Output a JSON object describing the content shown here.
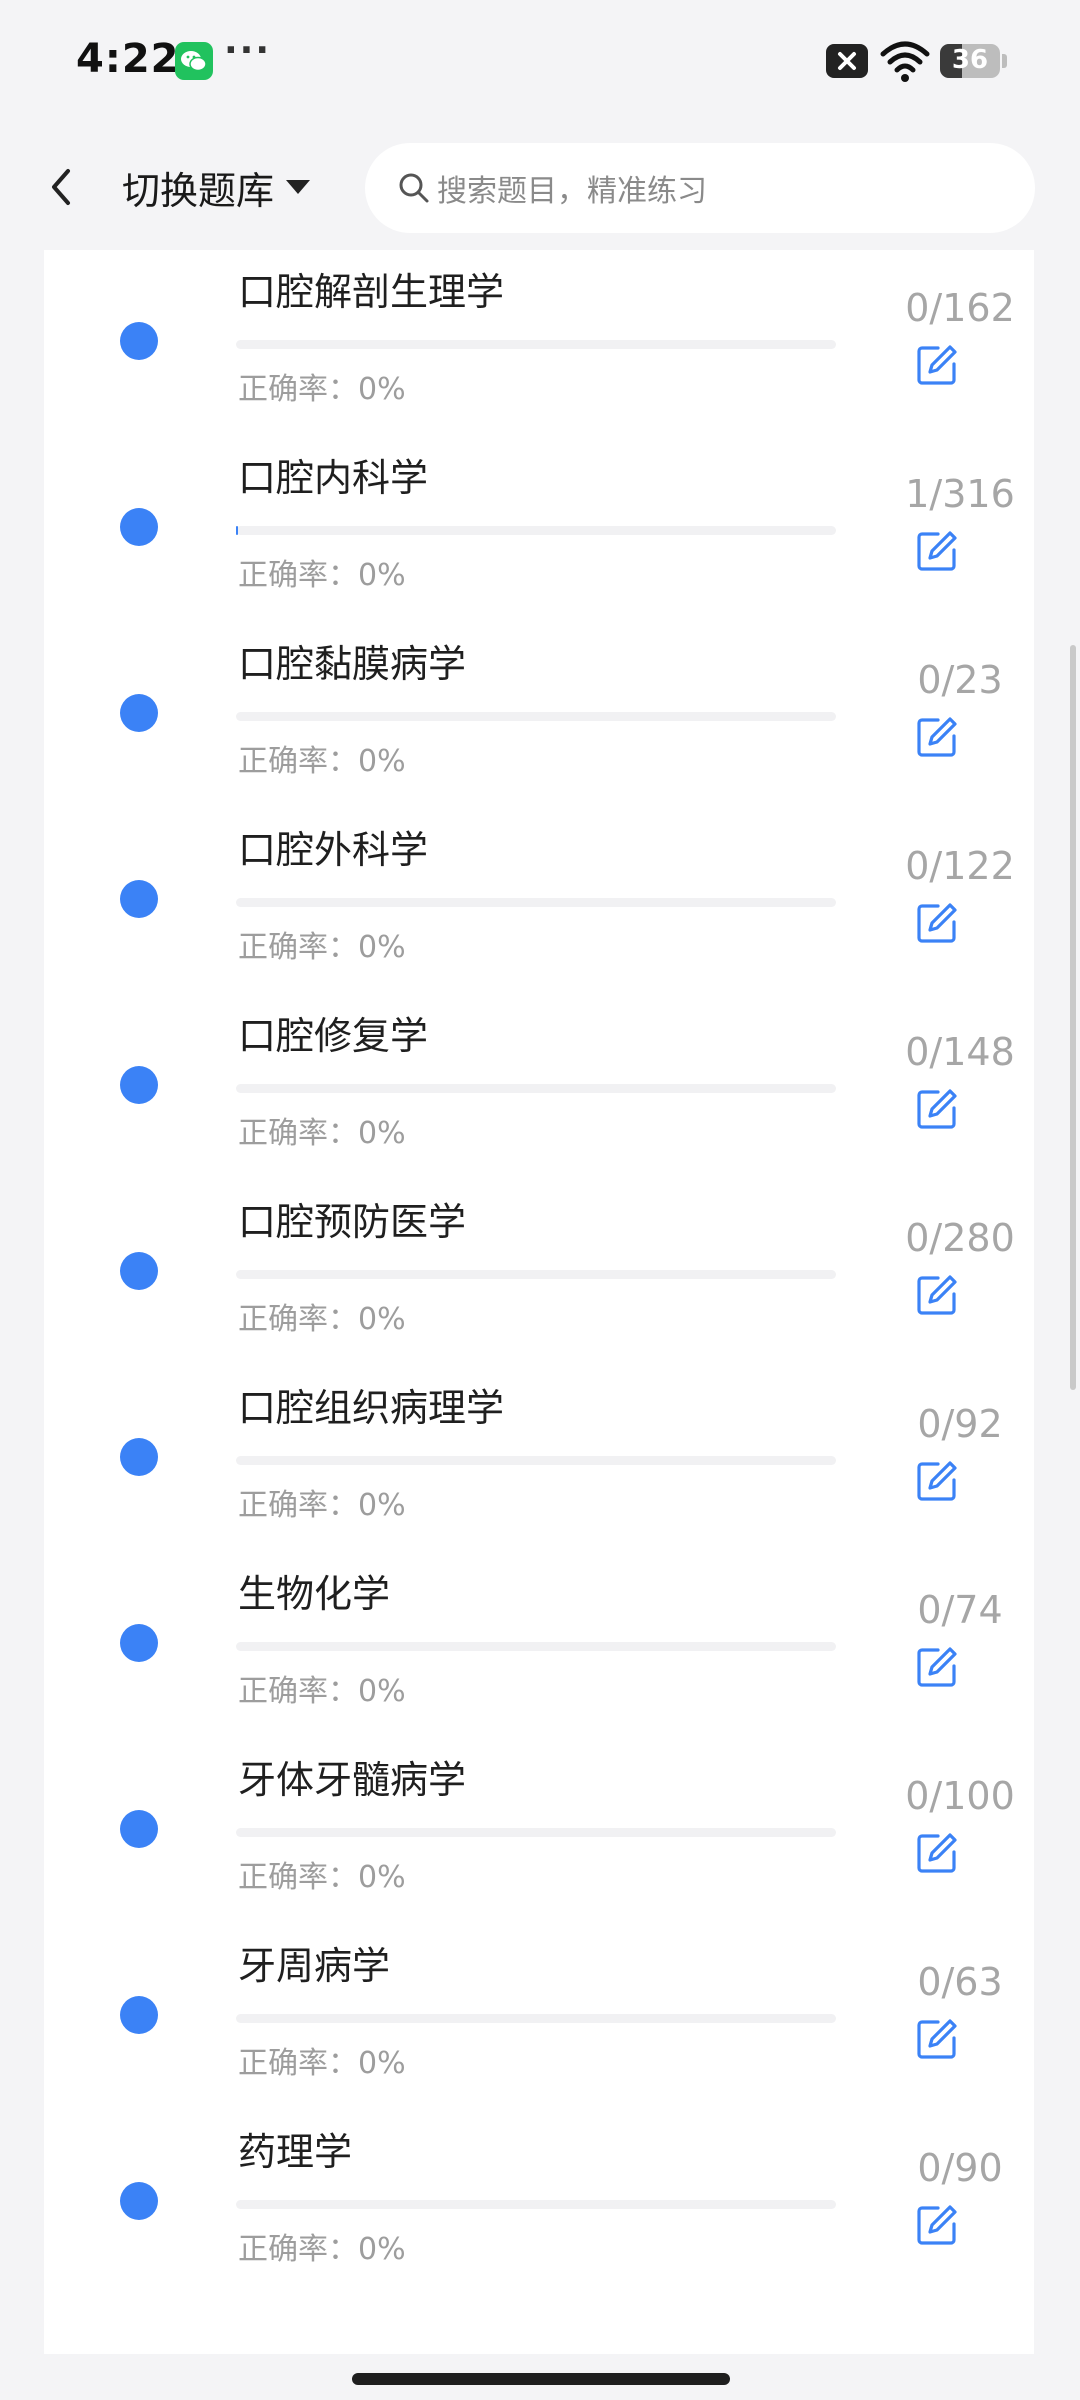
{
  "status_bar": {
    "time": "4:22",
    "more": "···",
    "battery_level": "36",
    "battery_fraction": 0.36,
    "icons": [
      "wechat-icon",
      "close-badge-icon",
      "wifi-icon",
      "battery-icon"
    ]
  },
  "header": {
    "back_icon": "chevron-left-icon",
    "switch_bank_label": "切换题库",
    "caret_icon": "caret-down-icon",
    "search_placeholder": "搜索题目，精准练习",
    "search_icon": "search-icon"
  },
  "colors": {
    "accent": "#3b82f6",
    "background": "#f4f4f6",
    "card": "#ffffff",
    "muted_text": "#9d9d9d"
  },
  "subjects": [
    {
      "name": "口腔解剖生理学",
      "accuracy": "正确率：0%",
      "count": "0/162",
      "progress": 0
    },
    {
      "name": "口腔内科学",
      "accuracy": "正确率：0%",
      "count": "1/316",
      "progress": 0.0032
    },
    {
      "name": "口腔黏膜病学",
      "accuracy": "正确率：0%",
      "count": "0/23",
      "progress": 0
    },
    {
      "name": "口腔外科学",
      "accuracy": "正确率：0%",
      "count": "0/122",
      "progress": 0
    },
    {
      "name": "口腔修复学",
      "accuracy": "正确率：0%",
      "count": "0/148",
      "progress": 0
    },
    {
      "name": "口腔预防医学",
      "accuracy": "正确率：0%",
      "count": "0/280",
      "progress": 0
    },
    {
      "name": "口腔组织病理学",
      "accuracy": "正确率：0%",
      "count": "0/92",
      "progress": 0
    },
    {
      "name": "生物化学",
      "accuracy": "正确率：0%",
      "count": "0/74",
      "progress": 0
    },
    {
      "name": "牙体牙髓病学",
      "accuracy": "正确率：0%",
      "count": "0/100",
      "progress": 0
    },
    {
      "name": "牙周病学",
      "accuracy": "正确率：0%",
      "count": "0/63",
      "progress": 0
    },
    {
      "name": "药理学",
      "accuracy": "正确率：0%",
      "count": "0/90",
      "progress": 0
    }
  ],
  "cut_off_row_text": "… … …"
}
